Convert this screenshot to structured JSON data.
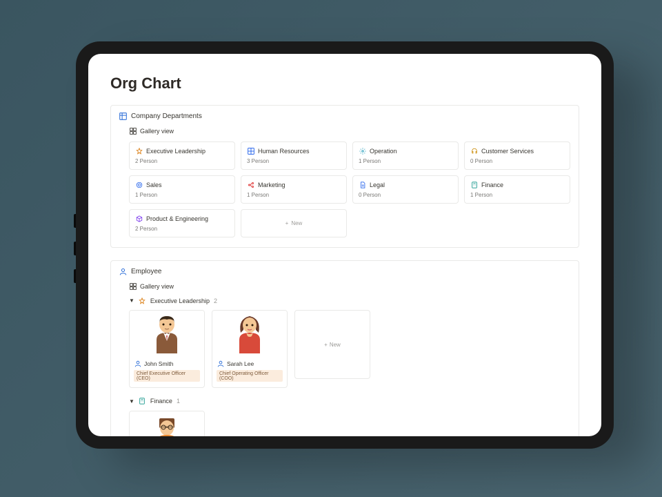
{
  "page": {
    "title": "Org Chart"
  },
  "departments_db": {
    "title": "Company Departments",
    "view_label": "Gallery view",
    "new_label": "New",
    "cards": [
      {
        "icon": "star",
        "icon_color": "#d97706",
        "name": "Executive Leadership",
        "count": "2 Person"
      },
      {
        "icon": "grid",
        "icon_color": "#2563eb",
        "name": "Human Resources",
        "count": "3 Person"
      },
      {
        "icon": "gear",
        "icon_color": "#0891b2",
        "name": "Operation",
        "count": "1 Person"
      },
      {
        "icon": "headset",
        "icon_color": "#ca8a04",
        "name": "Customer Services",
        "count": "0 Person"
      },
      {
        "icon": "target",
        "icon_color": "#2563eb",
        "name": "Sales",
        "count": "1 Person"
      },
      {
        "icon": "share",
        "icon_color": "#dc2626",
        "name": "Marketing",
        "count": "1 Person"
      },
      {
        "icon": "doc",
        "icon_color": "#2563eb",
        "name": "Legal",
        "count": "0 Person"
      },
      {
        "icon": "calc",
        "icon_color": "#0d9488",
        "name": "Finance",
        "count": "1 Person"
      },
      {
        "icon": "cube",
        "icon_color": "#7c3aed",
        "name": "Product & Engineering",
        "count": "2 Person"
      }
    ]
  },
  "employee_db": {
    "title": "Employee",
    "view_label": "Gallery view",
    "new_label": "New",
    "groups": [
      {
        "icon": "star",
        "icon_color": "#d97706",
        "name": "Executive Leadership",
        "count": "2",
        "employees": [
          {
            "name": "John Smith",
            "role": "Chief Executive Officer (CEO)",
            "avatar": "man-brown"
          },
          {
            "name": "Sarah Lee",
            "role": "Chief Operating Officer (COO)",
            "avatar": "woman-red"
          }
        ]
      },
      {
        "icon": "calc",
        "icon_color": "#0d9488",
        "name": "Finance",
        "count": "1",
        "employees": [
          {
            "name": "",
            "role": "",
            "avatar": "man-orange"
          }
        ]
      }
    ]
  },
  "icons": {
    "grid_blue": "#2e6fd8",
    "gallery": "#37352f",
    "person_ico": "#2e6fd8"
  }
}
